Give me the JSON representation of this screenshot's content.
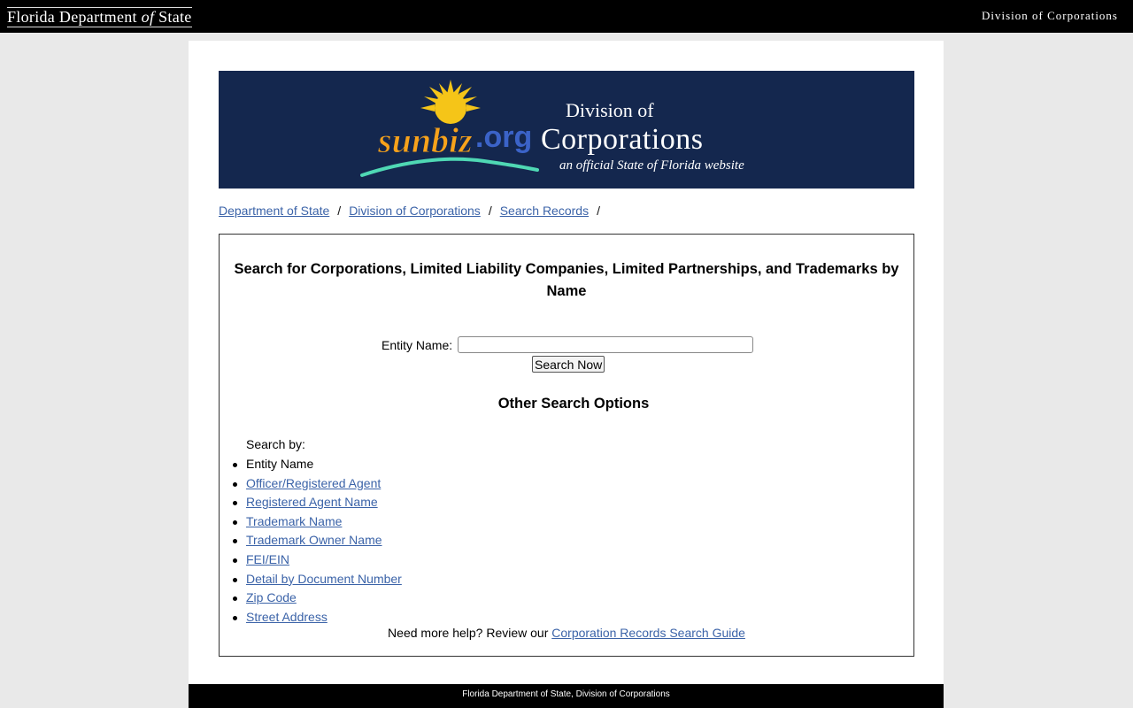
{
  "topbar": {
    "left_title_pre": "Florida Department ",
    "left_title_of": "of",
    "left_title_post": " State",
    "right_title": "Division of Corporations"
  },
  "banner": {
    "logo_sun": "sunbiz",
    "logo_org": ".org",
    "title_line1": "Division of",
    "title_line2": "Corporations",
    "tagline": "an official State of Florida website",
    "colors": {
      "background": "#14274e",
      "sun": "#f5c518",
      "org": "#3b63c8",
      "wave": "#4fd8b4"
    }
  },
  "breadcrumb": {
    "items": [
      "Department of State",
      "Division of Corporations",
      "Search Records"
    ],
    "separator": "/"
  },
  "search": {
    "heading": "Search for Corporations, Limited Liability Companies, Limited Partnerships, and Trademarks by Name",
    "entity_label": "Entity Name:",
    "entity_value": "",
    "button_label": "Search Now"
  },
  "other": {
    "heading": "Other Search Options",
    "search_by_label": "Search by:",
    "current_option": "Entity Name",
    "links": [
      "Officer/Registered Agent",
      "Registered Agent Name",
      "Trademark Name",
      "Trademark Owner Name",
      "FEI/EIN",
      "Detail by Document Number",
      "Zip Code",
      "Street Address"
    ]
  },
  "help": {
    "text": "Need more help? Review our",
    "link": "Corporation Records Search Guide"
  },
  "footer": {
    "text": "Florida Department of State, Division of Corporations"
  }
}
